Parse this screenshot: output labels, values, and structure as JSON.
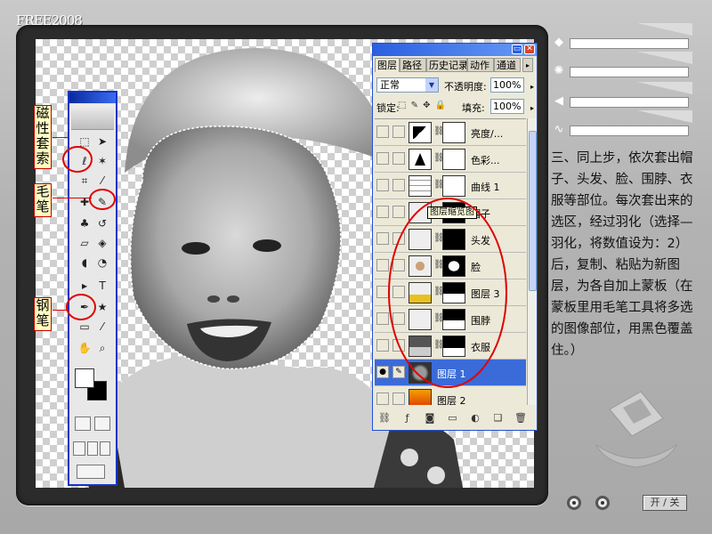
{
  "frame": {
    "logo": "FREE2008",
    "power_button_label": "开 / 关"
  },
  "annotations": {
    "magnetic_lasso": "磁性套索",
    "brush": "毛笔",
    "pen": "钢笔"
  },
  "description": "三、同上步，依次套出帽子、头发、脸、围脖、衣服等部位。每次套出来的选区，经过羽化（选择—羽化，将数值设为：2）后，复制、粘贴为新图层，为各自加上蒙板（在蒙板里用毛笔工具将多选的图像部位，用黑色覆盖住。）",
  "layers_palette": {
    "tabs": [
      "图层",
      "路径",
      "历史记录",
      "动作",
      "通道"
    ],
    "blend_mode": "正常",
    "opacity_label": "不透明度:",
    "opacity_value": "100%",
    "lock_label": "锁定:",
    "fill_label": "填充:",
    "fill_value": "100%",
    "tooltip": "图层缩览图",
    "layers": [
      {
        "name": "亮度/..."
      },
      {
        "name": "色彩..."
      },
      {
        "name": "曲线 1"
      },
      {
        "name": "帽子"
      },
      {
        "name": "头发"
      },
      {
        "name": "脸"
      },
      {
        "name": "图层 3"
      },
      {
        "name": "围脖"
      },
      {
        "name": "衣服"
      },
      {
        "name": "图层 1",
        "selected": true
      },
      {
        "name": "图层 2"
      }
    ]
  },
  "colors": {
    "accent_red": "#e00000",
    "selection_blue": "#3a6bd9",
    "toolbox_border": "#1433c9"
  }
}
